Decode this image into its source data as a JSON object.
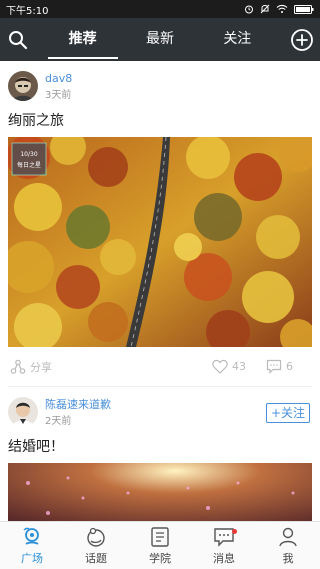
{
  "status_bar": {
    "time": "下午5:10",
    "icons": [
      "alarm-icon",
      "mute-icon",
      "wifi-icon",
      "battery-icon"
    ]
  },
  "top_nav": {
    "tabs": [
      {
        "label": "推荐",
        "active": true
      },
      {
        "label": "最新",
        "active": false
      },
      {
        "label": "关注",
        "active": false
      }
    ],
    "left_icon": "search-icon",
    "right_icon": "add-circle-icon"
  },
  "posts": [
    {
      "author": "dav8",
      "date": "3天前",
      "title": "绚丽之旅",
      "image_badge": {
        "date": "10/30",
        "text": "每日之星"
      },
      "share_label": "分享",
      "likes": "43",
      "comments": "6"
    },
    {
      "author": "陈磊速来道歉",
      "date": "2天前",
      "title": "结婚吧！",
      "follow_label": "+关注"
    }
  ],
  "bottom_nav": [
    {
      "label": "广场",
      "icon": "plaza-icon",
      "active": true
    },
    {
      "label": "话题",
      "icon": "topic-icon",
      "active": false
    },
    {
      "label": "学院",
      "icon": "academy-icon",
      "active": false
    },
    {
      "label": "消息",
      "icon": "message-icon",
      "active": false,
      "badge": true
    },
    {
      "label": "我",
      "icon": "profile-icon",
      "active": false
    }
  ],
  "colors": {
    "accent": "#2b90d9",
    "nav_bg": "#2e3338",
    "link": "#4a90d9"
  }
}
